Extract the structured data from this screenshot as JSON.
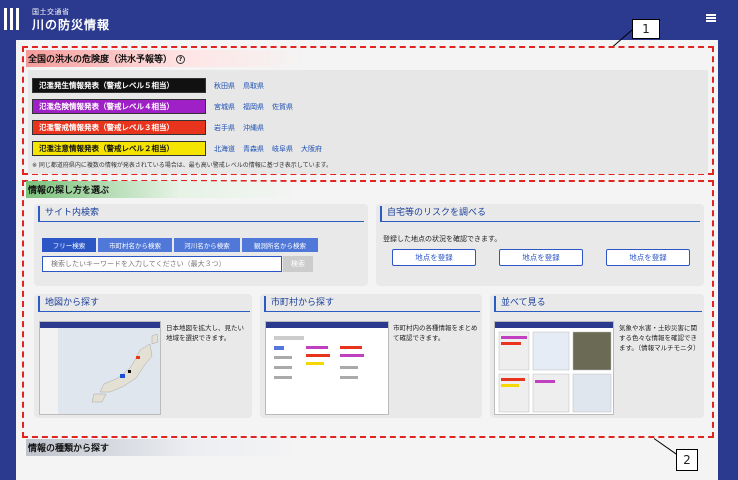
{
  "header": {
    "ministry": "国土交通省",
    "title": "川の防災情報"
  },
  "callouts": {
    "one": "1",
    "two": "2"
  },
  "flood": {
    "title": "全国の洪水の危険度（洪水予報等）",
    "help": "?",
    "levels": [
      {
        "label": "氾濫発生情報発表（警戒レベル５相当）",
        "color": "#111111",
        "prefs": [
          "秋田県",
          "鳥取県"
        ]
      },
      {
        "label": "氾濫危険情報発表（警戒レベル４相当）",
        "color": "#a020c8",
        "prefs": [
          "宮城県",
          "福岡県",
          "佐賀県"
        ]
      },
      {
        "label": "氾濫警戒情報発表（警戒レベル３相当）",
        "color": "#e8341c",
        "prefs": [
          "岩手県",
          "沖縄県"
        ]
      },
      {
        "label": "氾濫注意情報発表（警戒レベル２相当）",
        "color": "#f5e300",
        "text_color": "#111111",
        "prefs": [
          "北海道",
          "青森県",
          "岐阜県",
          "大阪府"
        ]
      }
    ],
    "note": "※ 同じ都道府県内に複数の情報が発表されている場合は、最も高い警戒レベルの情報に基づき表示しています。"
  },
  "search_section": {
    "title": "情報の探し方を選ぶ",
    "site_search": {
      "title": "サイト内検索",
      "tabs": [
        "フリー検索",
        "市町村名から検索",
        "河川名から検索",
        "観測所名から検索"
      ],
      "placeholder": "検索したいキーワードを入力してください（最大３つ）",
      "button": "検索"
    },
    "risk": {
      "title": "自宅等のリスクを調べる",
      "description": "登録した地点の状況を確認できます。",
      "buttons": [
        "地点を登録",
        "地点を登録",
        "地点を登録"
      ]
    },
    "map": {
      "title": "地図から探す",
      "description": "日本地図を拡大し、見たい地域を選択できます。"
    },
    "city": {
      "title": "市町村から探す",
      "description": "市町村内の各種情報をまとめて確認できます。"
    },
    "list": {
      "title": "並べて見る",
      "description": "気象や水害・土砂災害に関する色々な情報を確認できます。（情報マルチモニタ）"
    }
  },
  "types_section": {
    "title": "情報の種類から探す"
  }
}
